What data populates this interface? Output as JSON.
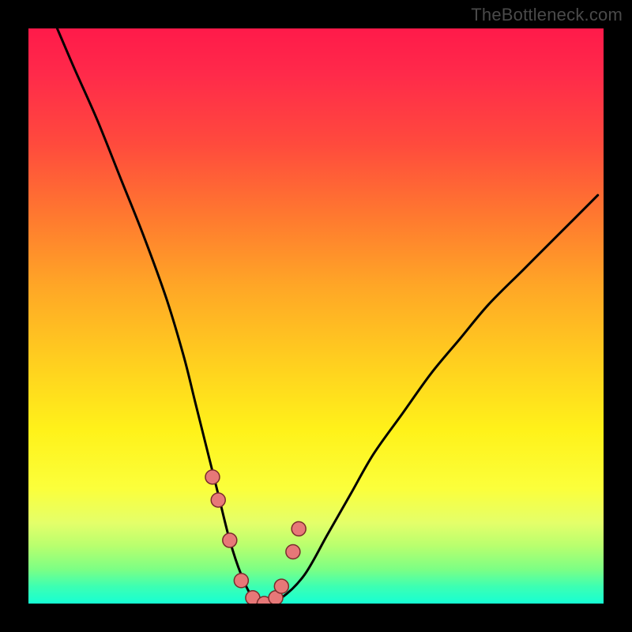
{
  "watermark": "TheBottleneck.com",
  "colors": {
    "frame": "#000000",
    "curve": "#000000",
    "marker_fill": "#e77878",
    "marker_stroke": "#7a2c2c",
    "gradient_top": "#ff1a4a",
    "gradient_bottom": "#16ffd4"
  },
  "chart_data": {
    "type": "line",
    "title": "",
    "xlabel": "",
    "ylabel": "",
    "xlim": [
      0,
      100
    ],
    "ylim": [
      0,
      100
    ],
    "curve": {
      "name": "bottleneck-curve",
      "x": [
        5,
        8,
        12,
        16,
        20,
        24,
        27,
        29,
        31,
        33,
        35,
        37,
        39,
        41,
        44,
        48,
        52,
        56,
        60,
        65,
        70,
        75,
        80,
        86,
        92,
        99
      ],
      "values": [
        100,
        93,
        84,
        74,
        64,
        53,
        43,
        35,
        27,
        19,
        11,
        5,
        1,
        0,
        1,
        5,
        12,
        19,
        26,
        33,
        40,
        46,
        52,
        58,
        64,
        71
      ]
    },
    "markers": {
      "name": "highlighted-points",
      "x": [
        32,
        33,
        35,
        37,
        39,
        41,
        43,
        44,
        46,
        47
      ],
      "values": [
        22,
        18,
        11,
        4,
        1,
        0,
        1,
        3,
        9,
        13
      ]
    }
  }
}
